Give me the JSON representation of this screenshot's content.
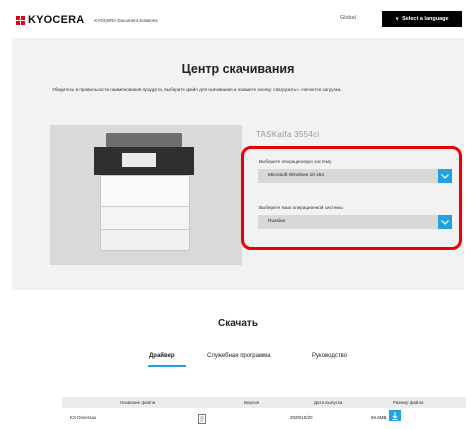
{
  "header": {
    "logo_text": "KYOCERA",
    "logo_subtitle": "KYOCERA Document Solutions",
    "global_label": "Global",
    "language_button": "Select a language",
    "brand_red": "#e60012"
  },
  "hero": {
    "title": "Центр скачивания",
    "description": "Убедитесь в правильности наименования продукта, выберите файл для скачивания и нажмите кнопку «Загрузить». Начнется загрузка.",
    "model_name": "TASKalfa 3554ci",
    "os_label": "Выберите операционную систему",
    "os_value": "Microsoft Windows 10 x64",
    "lang_label": "Выберите язык операционной системы",
    "lang_value": "Russian",
    "accent": "#1fa3e0",
    "highlight_color": "#ea0000"
  },
  "downloads": {
    "title": "Скачать",
    "tabs": [
      {
        "label": "Драйвер",
        "active": true
      },
      {
        "label": "Служебная программа",
        "active": false
      },
      {
        "label": "Руководство",
        "active": false
      }
    ],
    "columns": {
      "name": "Название файла",
      "version": "Версия",
      "date": "Дата выпуска",
      "size": "Размер файла"
    },
    "rows": [
      {
        "name": "KX Driverзаx",
        "version": "",
        "date": "2020/10/20",
        "size": "66.6MB"
      }
    ]
  }
}
